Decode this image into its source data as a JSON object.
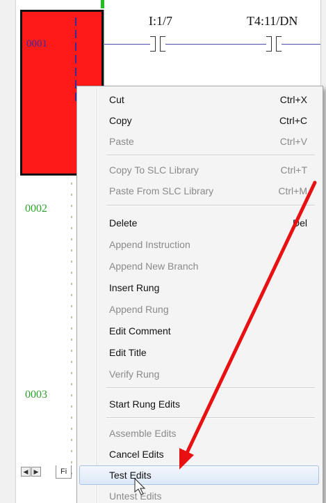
{
  "ladder": {
    "rungs": [
      "0001",
      "0002",
      "0003"
    ],
    "instructions": [
      {
        "address": "I:1/7",
        "type": "XIC"
      },
      {
        "address": "T4:11/DN",
        "type": "XIC"
      }
    ],
    "selection_color": "#ff1a1a"
  },
  "file_tab": {
    "label": "Fi"
  },
  "context_menu": {
    "items": [
      {
        "label": "Cut",
        "shortcut": "Ctrl+X",
        "enabled": true
      },
      {
        "label": "Copy",
        "shortcut": "Ctrl+C",
        "enabled": true
      },
      {
        "label": "Paste",
        "shortcut": "Ctrl+V",
        "enabled": false
      },
      {
        "label": "Copy To SLC Library",
        "shortcut": "Ctrl+T",
        "enabled": false
      },
      {
        "label": "Paste From SLC Library",
        "shortcut": "Ctrl+M",
        "enabled": false
      },
      {
        "label": "Delete",
        "shortcut": "Del",
        "enabled": true
      },
      {
        "label": "Append Instruction",
        "shortcut": "",
        "enabled": false
      },
      {
        "label": "Append New Branch",
        "shortcut": "",
        "enabled": false
      },
      {
        "label": "Insert Rung",
        "shortcut": "",
        "enabled": true
      },
      {
        "label": "Append Rung",
        "shortcut": "",
        "enabled": false
      },
      {
        "label": "Edit Comment",
        "shortcut": "",
        "enabled": true
      },
      {
        "label": "Edit Title",
        "shortcut": "",
        "enabled": true
      },
      {
        "label": "Verify Rung",
        "shortcut": "",
        "enabled": false
      },
      {
        "label": "Start Rung Edits",
        "shortcut": "",
        "enabled": true
      },
      {
        "label": "Assemble Edits",
        "shortcut": "",
        "enabled": false
      },
      {
        "label": "Cancel Edits",
        "shortcut": "",
        "enabled": true
      },
      {
        "label": "Test Edits",
        "shortcut": "",
        "enabled": true,
        "highlighted": true
      },
      {
        "label": "Untest Edits",
        "shortcut": "",
        "enabled": false
      }
    ]
  },
  "annotation": {
    "arrow_color": "#e81010",
    "points_to": "Test Edits"
  }
}
